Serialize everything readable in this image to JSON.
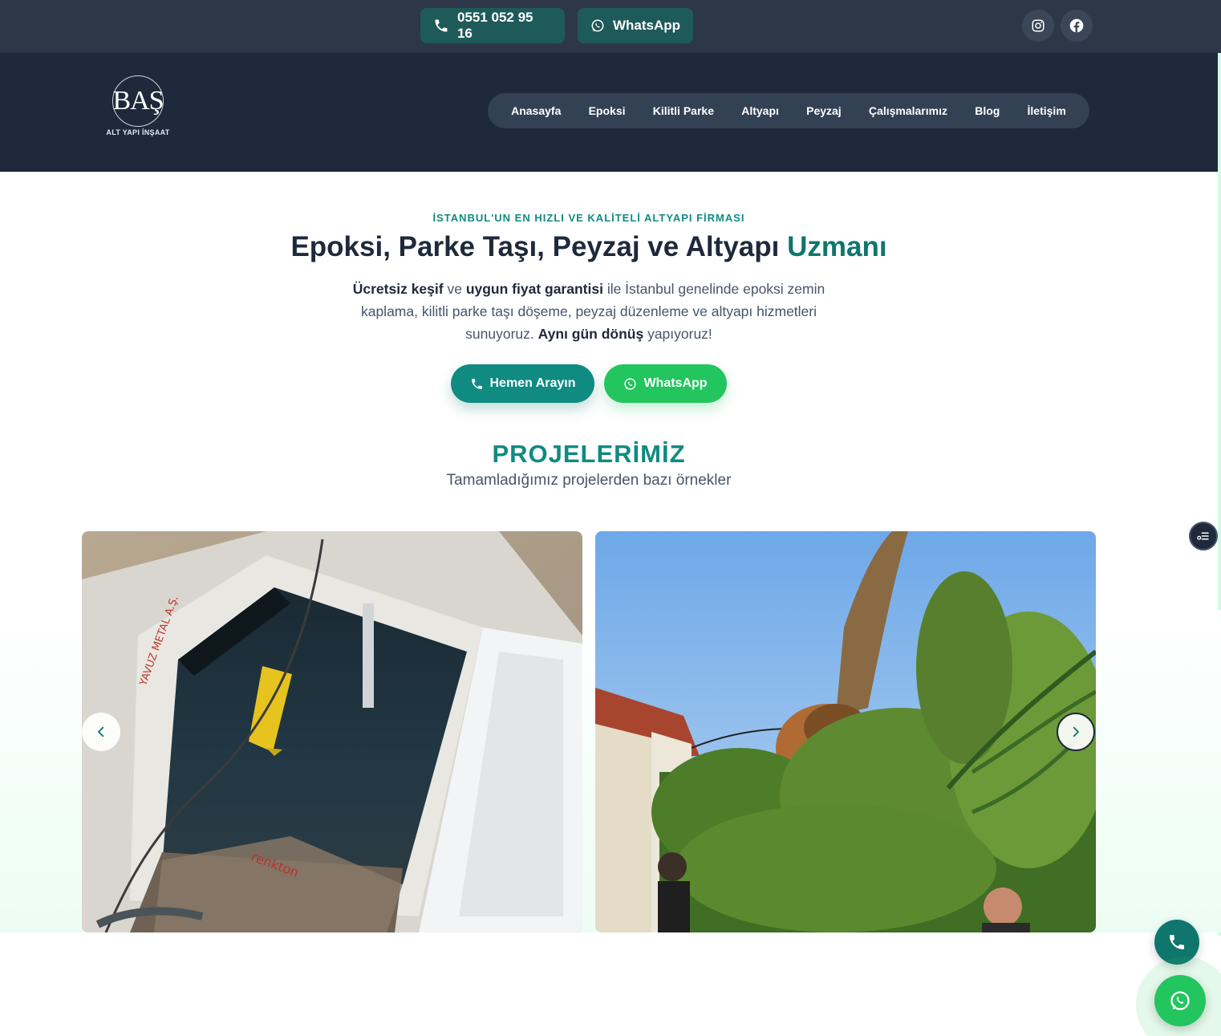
{
  "topbar": {
    "phone_label": "0551 052 95 16",
    "whatsapp_label": "WhatsApp",
    "socials": [
      "instagram-icon",
      "facebook-icon"
    ]
  },
  "header": {
    "logo_mark": "BAŞ",
    "logo_text": "ALT YAPI İNŞAAT",
    "nav": [
      "Anasayfa",
      "Epoksi",
      "Kilitli Parke",
      "Altyapı",
      "Peyzaj",
      "Çalışmalarımız",
      "Blog",
      "İletişim"
    ]
  },
  "hero": {
    "tagline": "İSTANBUL'UN EN HIZLI VE KALİTELİ ALTYAPI FİRMASI",
    "title_main": "Epoksi, Parke Taşı, Peyzaj ve Altyapı",
    "title_accent": "Uzmanı",
    "desc_b1": "Ücretsiz keşif",
    "desc_t1": " ve ",
    "desc_b2": "uygun fiyat garantisi",
    "desc_t2": " ile İstanbul genelinde epoksi zemin kaplama, kilitli parke taşı döşeme, peyzaj düzenleme ve altyapı hizmetleri sunuyoruz. ",
    "desc_b3": "Aynı gün dönüş",
    "desc_t3": " yapıyoruz!",
    "cta_call": "Hemen Arayın",
    "cta_whatsapp": "WhatsApp"
  },
  "projects": {
    "title": "PROJELERİMİZ",
    "subtitle": "Tamamladığımız projelerden bazı örnekler"
  },
  "colors": {
    "topbar": "#2d3748",
    "header": "#1e293b",
    "accent": "#0f8b82",
    "whatsapp": "#22c55e"
  }
}
